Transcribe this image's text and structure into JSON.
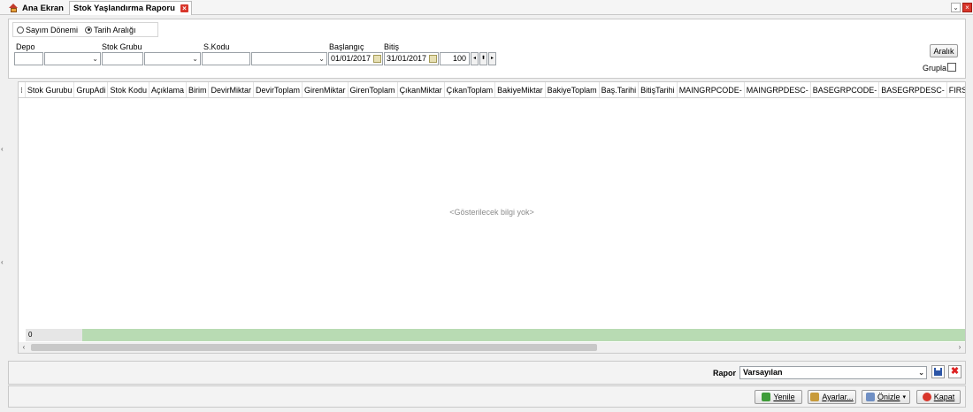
{
  "tabs": [
    {
      "label": "Ana Ekran"
    },
    {
      "label": "Stok Yaşlandırma Raporu"
    }
  ],
  "filter": {
    "radios": [
      {
        "label": "Sayım Dönemi",
        "checked": false
      },
      {
        "label": "Tarih Aralığı",
        "checked": true
      }
    ],
    "labels": {
      "depo": "Depo",
      "stok_grubu": "Stok Grubu",
      "s_kodu": "S.Kodu",
      "baslangic": "Başlangıç",
      "bitis": "Bitiş",
      "grupla": "Grupla"
    },
    "baslangic_value": "01/01/2017",
    "bitis_value": "31/01/2017",
    "aralik_value": "100",
    "aralik_button": "Aralık"
  },
  "grid": {
    "columns": [
      "Stok Gurubu",
      "GrupAdi",
      "Stok Kodu",
      "Açıklama",
      "Birim",
      "DevirMiktar",
      "DevirToplam",
      "GirenMiktar",
      "GirenToplam",
      "ÇıkanMiktar",
      "ÇıkanToplam",
      "BakiyeMiktar",
      "BakiyeToplam",
      "Baş.Tarihi",
      "BitişTarihi",
      "MAINGRPCODE-",
      "MAINGRPDESC-",
      "BASEGRPCODE-",
      "BASEGRPDESC-",
      "FIRSTENTDA"
    ],
    "empty_text": "<Gösterilecek bilgi yok>",
    "footer_count": "0"
  },
  "report": {
    "label": "Rapor",
    "selected": "Varsayılan"
  },
  "actions": {
    "yenile": "Yenile",
    "ayarlar": "Ayarlar...",
    "onizle": "Önizle",
    "kapat": "Kapat"
  },
  "colors": {
    "accent_close": "#d8362b",
    "footer_green": "#b8dbb3",
    "save_blue": "#2c55a6"
  }
}
